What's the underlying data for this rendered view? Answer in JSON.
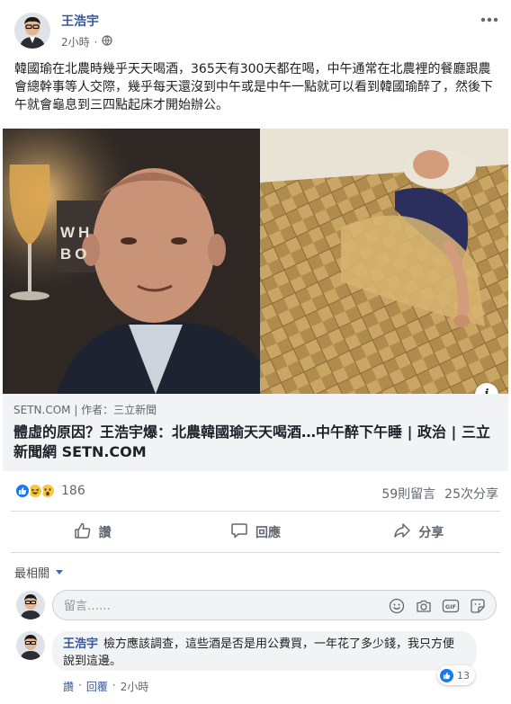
{
  "post": {
    "author": "王浩宇",
    "time": "2小時",
    "body": "韓國瑜在北農時幾乎天天喝酒，365天有300天都在喝，中午通常在北農裡的餐廳跟農會總幹事等人交際，幾乎每天還沒到中午或是中午一點就可以看到韓國瑜醉了，然後下午就會龜息到三四點起床才開始辦公。",
    "photo_sign_text": "WH\nBO",
    "more_icon": "more-dots-icon",
    "privacy_icon": "globe-icon"
  },
  "link_preview": {
    "source": "SETN.COM | 作者：三立新聞",
    "title": "體虛的原因？王浩宇爆：北農韓國瑜天天喝酒…中午醉下午睡 | 政治 | 三立新聞網 SETN.COM",
    "info_glyph": "i"
  },
  "reactions": {
    "count": "186",
    "types": [
      "like",
      "haha",
      "wow"
    ],
    "comments": "59則留言",
    "shares": "25次分享"
  },
  "actions": {
    "like": "讚",
    "comment": "回應",
    "share": "分享"
  },
  "comments_section": {
    "sort_label": "最相關",
    "input_placeholder": "留言……",
    "input_icons": [
      "emoji-icon",
      "camera-icon",
      "gif-icon",
      "sticker-icon"
    ]
  },
  "reply": {
    "author": "王浩宇",
    "text": "檢方應該調查，這些酒是否是用公費買，一年花了多少錢，我只方便說到這邊。",
    "reaction_count": "13",
    "like_label": "讚",
    "separator": "·",
    "reply_label": "回覆",
    "time": "2小時"
  },
  "colors": {
    "link_blue": "#385898",
    "like_blue": "#1877f2",
    "secondary_text": "#606770",
    "preview_bg": "#f2f3f5"
  }
}
